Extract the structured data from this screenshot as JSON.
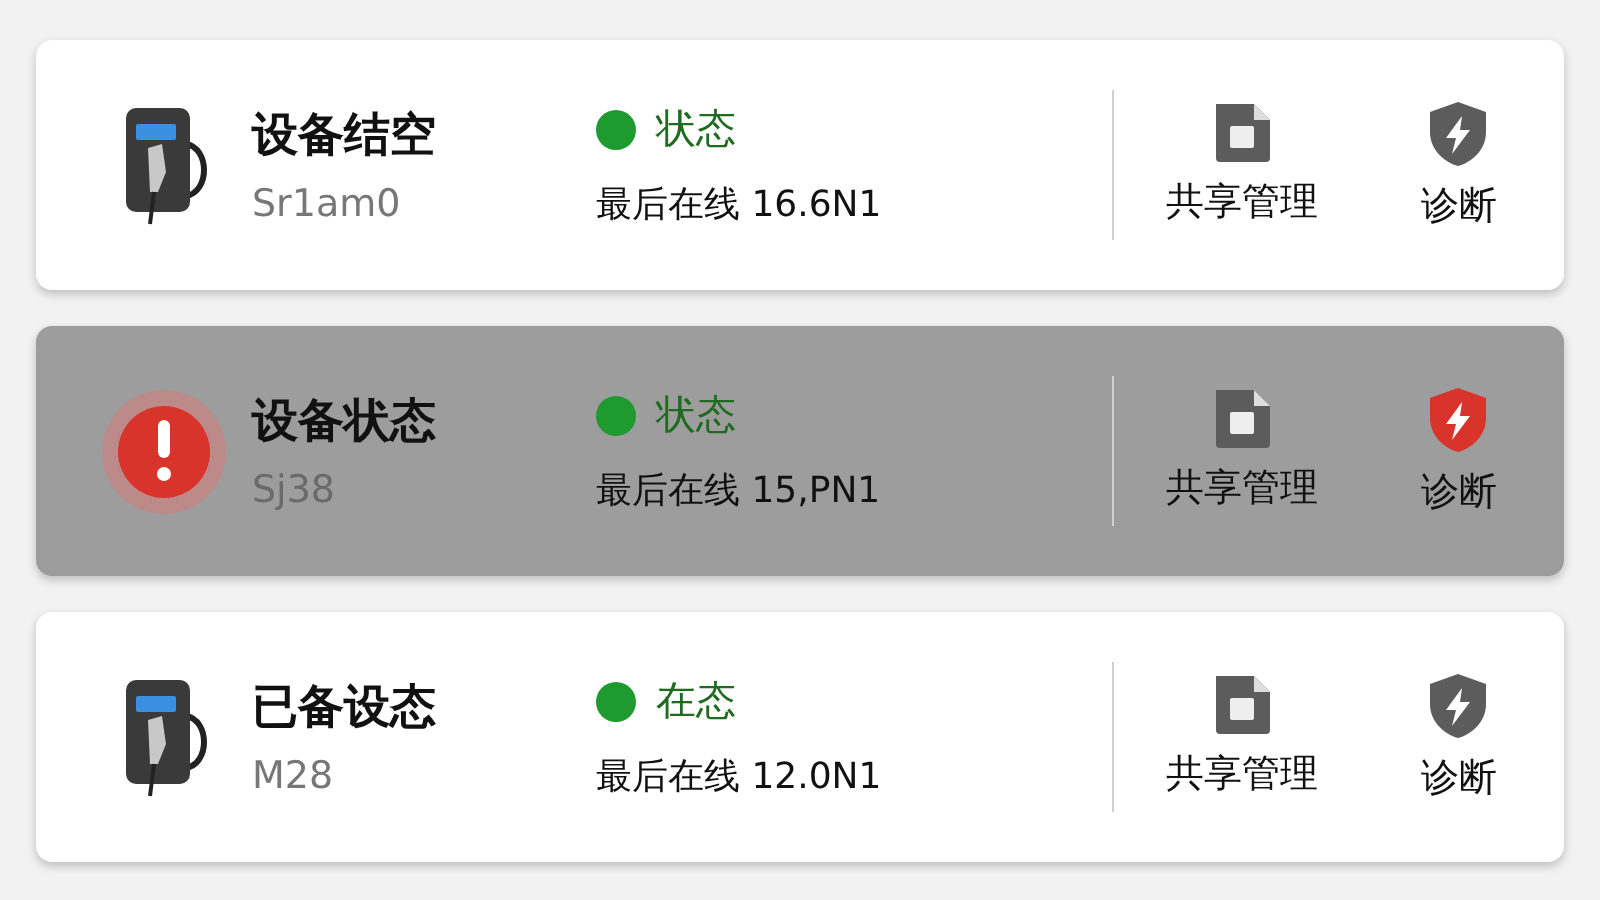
{
  "devices": [
    {
      "name": "设备结空",
      "model": "Sr1am0",
      "alert": false,
      "status": "状态",
      "last_online": "最后在线 16.6N1",
      "actions": [
        "共享管理",
        "诊断"
      ]
    },
    {
      "name": "设备状态",
      "model": "Sj38",
      "alert": true,
      "status": "状态",
      "last_online": "最后在线 15,PN1",
      "actions": [
        "共享管理",
        "诊断"
      ]
    },
    {
      "name": "已备设态",
      "model": "M28",
      "alert": false,
      "status": "在态",
      "last_online": "最后在线 12.0N1",
      "actions": [
        "共享管理",
        "诊断"
      ]
    }
  ]
}
